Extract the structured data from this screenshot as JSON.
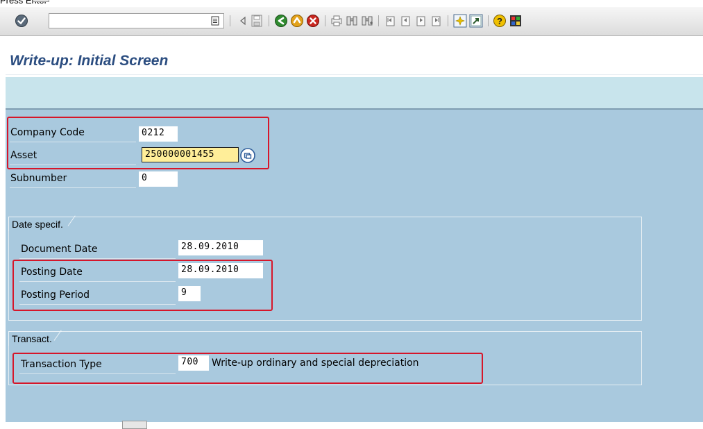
{
  "instruction": {
    "text": "Press  Enter"
  },
  "toolbar": {
    "command_value": "",
    "icons": {
      "enter": "check-icon",
      "history": "history-icon",
      "back_nav": "triangle-left-icon",
      "save": "save-icon",
      "back": "back-icon",
      "exit": "exit-icon",
      "cancel": "cancel-icon",
      "print": "print-icon",
      "find": "find-icon",
      "find_next": "find-next-icon",
      "first_page": "first-page-icon",
      "prev_page": "previous-page-icon",
      "next_page": "next-page-icon",
      "last_page": "last-page-icon",
      "new_session": "new-session-icon",
      "shortcut": "shortcut-icon",
      "help": "help-icon",
      "layout": "layout-icon"
    }
  },
  "title": "Write-up: Initial Screen",
  "fields": {
    "company_code": {
      "label": "Company Code",
      "value": "0212"
    },
    "asset": {
      "label": "Asset",
      "value": "250000001455"
    },
    "subnumber": {
      "label": "Subnumber",
      "value": "0"
    }
  },
  "date_group": {
    "title": "Date specif.",
    "document_date": {
      "label": "Document Date",
      "value": "28.09.2010"
    },
    "posting_date": {
      "label": "Posting Date",
      "value": "28.09.2010"
    },
    "posting_period": {
      "label": "Posting Period",
      "value": "9"
    }
  },
  "transact_group": {
    "title": "Transact.",
    "transaction_type": {
      "label": "Transaction Type",
      "value": "700",
      "description": "Write-up ordinary and special depreciation"
    }
  },
  "colors": {
    "title": "#2b4d80",
    "band": "#c8e4ec",
    "body": "#a9c9de",
    "highlight": "#d6162a",
    "focus_field": "#ffee99"
  }
}
